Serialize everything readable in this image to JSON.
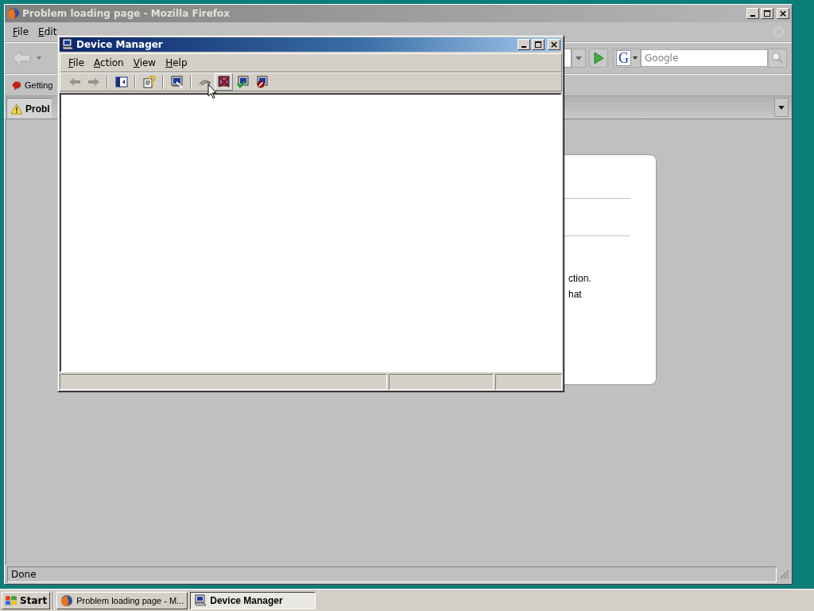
{
  "firefox": {
    "title": "Problem loading page - Mozilla Firefox",
    "menu": [
      "File",
      "Edit"
    ],
    "search_engine": "G",
    "search_placeholder": "Google",
    "bookmarks": [
      "Getting"
    ],
    "tabs": [
      {
        "label": "Probl",
        "selected": true
      }
    ],
    "error_text": [
      "ction.",
      "hat"
    ],
    "status": "Done"
  },
  "device_manager": {
    "title": "Device Manager",
    "menu": [
      "File",
      "Action",
      "View",
      "Help"
    ],
    "toolbar_groups": [
      [
        {
          "kind": "back",
          "disabled": true,
          "hovered": false
        },
        {
          "kind": "forward",
          "disabled": true,
          "hovered": false
        }
      ],
      [
        {
          "kind": "tree",
          "disabled": false,
          "hovered": false
        }
      ],
      [
        {
          "kind": "help",
          "disabled": false,
          "hovered": false
        }
      ],
      [
        {
          "kind": "properties",
          "disabled": false,
          "hovered": false
        }
      ],
      [
        {
          "kind": "scan",
          "disabled": false,
          "hovered": false
        },
        {
          "kind": "uninstall",
          "disabled": false,
          "hovered": true
        },
        {
          "kind": "update",
          "disabled": false,
          "hovered": false
        },
        {
          "kind": "disable",
          "disabled": false,
          "hovered": false
        }
      ]
    ]
  },
  "taskbar": {
    "start": "Start",
    "tasks": [
      {
        "kind": "firefox",
        "label": "Problem loading page - M...",
        "selected": false
      },
      {
        "kind": "device",
        "label": "Device Manager",
        "selected": true
      }
    ]
  }
}
